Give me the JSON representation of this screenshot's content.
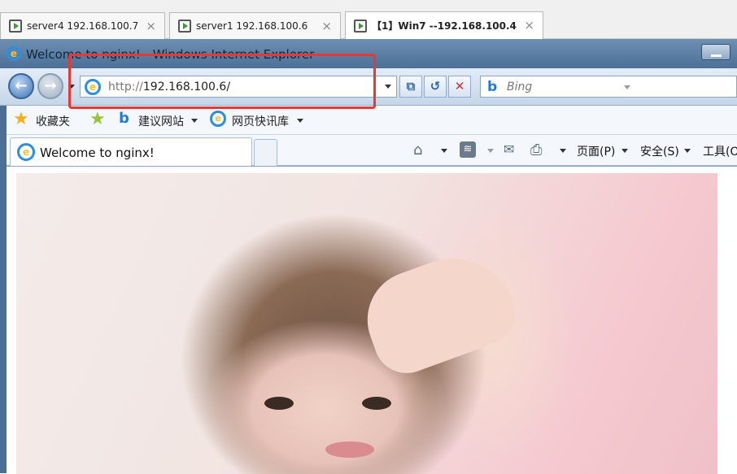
{
  "vm_tabs": [
    {
      "label": "server4 192.168.100.7",
      "close": "×"
    },
    {
      "label": "server1 192.168.100.6",
      "close": "×"
    },
    {
      "label": "【1】Win7 --192.168.100.4",
      "close": "×"
    }
  ],
  "window": {
    "title": "Welcome to nginx! - Windows Internet Explorer"
  },
  "nav": {
    "back_glyph": "←",
    "forward_glyph": "→",
    "address_scheme": "http://",
    "address_host": "192.168.100.6/",
    "search_placeholder": "Bing",
    "stop_glyph": "✕",
    "refresh_glyph": "↺",
    "compat_glyph": "⧉"
  },
  "favorites_bar": {
    "favorites_label": "收藏夹",
    "suggested_sites_label": "建议网站",
    "web_slice_label": "网页快讯库"
  },
  "tab_bar": {
    "active_tab_label": "Welcome to nginx!",
    "page_menu_label": "页面(P)",
    "safety_menu_label": "安全(S)",
    "tools_menu_label": "工具(O)"
  },
  "icons": {
    "home": "home-icon",
    "feeds": "rss-icon",
    "mail": "mail-icon",
    "print": "print-icon"
  },
  "colors": {
    "highlight": "#e53935",
    "ie_blue": "#2d8ee0"
  }
}
